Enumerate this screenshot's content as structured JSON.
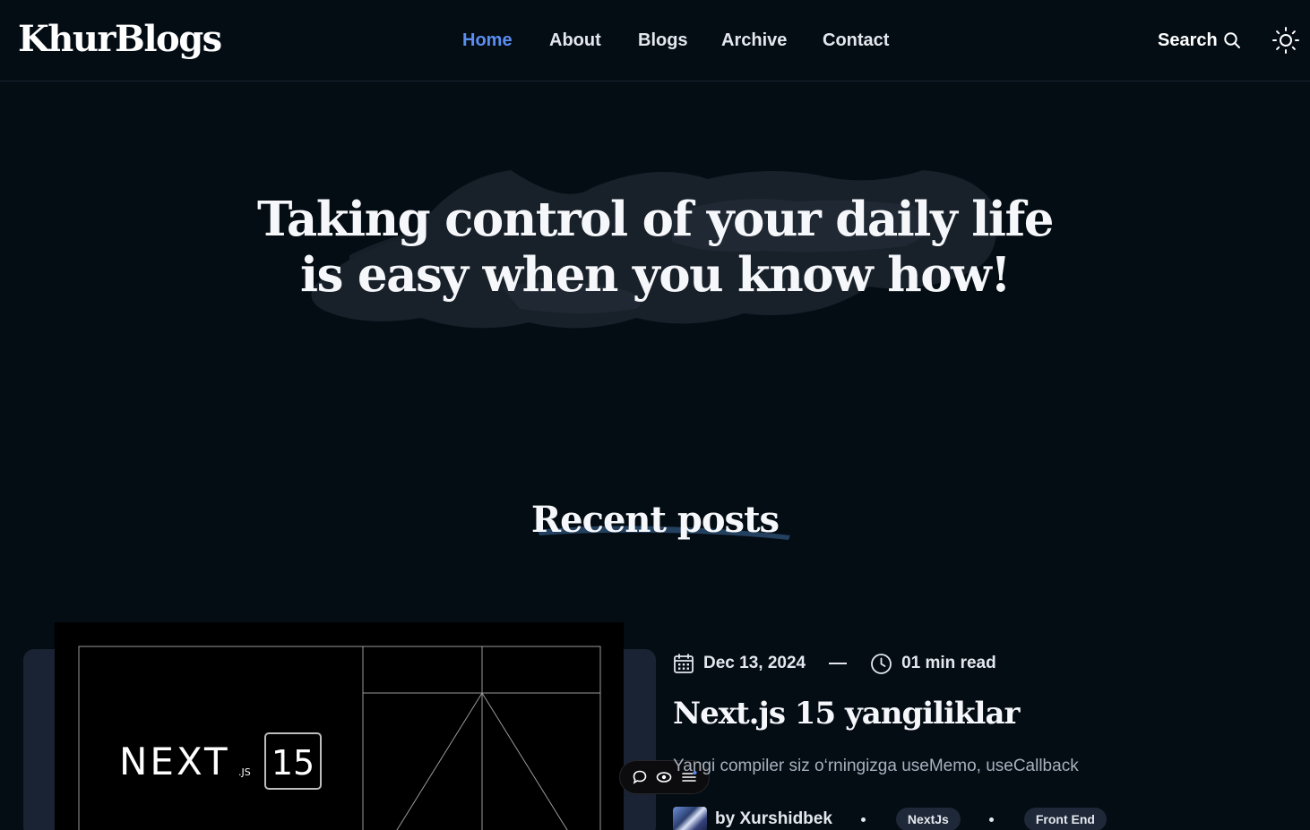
{
  "header": {
    "logo": "KhurBlogs",
    "nav": [
      {
        "label": "Home",
        "active": true
      },
      {
        "label": "About",
        "active": false
      },
      {
        "label": "Blogs",
        "active": false
      },
      {
        "label": "Archive",
        "active": false
      },
      {
        "label": "Contact",
        "active": false
      }
    ],
    "search_label": "Search",
    "search_icon": "search-icon",
    "theme_icon": "sun-icon"
  },
  "hero": {
    "line1": "Taking control of your daily life",
    "line2": "is easy when you know how!"
  },
  "recent": {
    "title": "Recent posts"
  },
  "post": {
    "image": {
      "brand": "NEXT",
      "brand_suffix": ".JS",
      "version": "15"
    },
    "date": "Dec 13, 2024",
    "read_time": "01 min read",
    "title": "Next.js 15 yangiliklar",
    "excerpt": "Yangi compiler siz o‘rningizga useMemo, useCallback",
    "author": "by Xurshidbek",
    "tags": [
      "NextJs",
      "Front End"
    ]
  },
  "floating_bar": {
    "icons": [
      "comment-icon",
      "eye-icon",
      "list-icon"
    ]
  },
  "colors": {
    "background": "#040c14",
    "accent": "#5b8ef0",
    "card": "#1a2333",
    "tag": "#1f2838"
  }
}
